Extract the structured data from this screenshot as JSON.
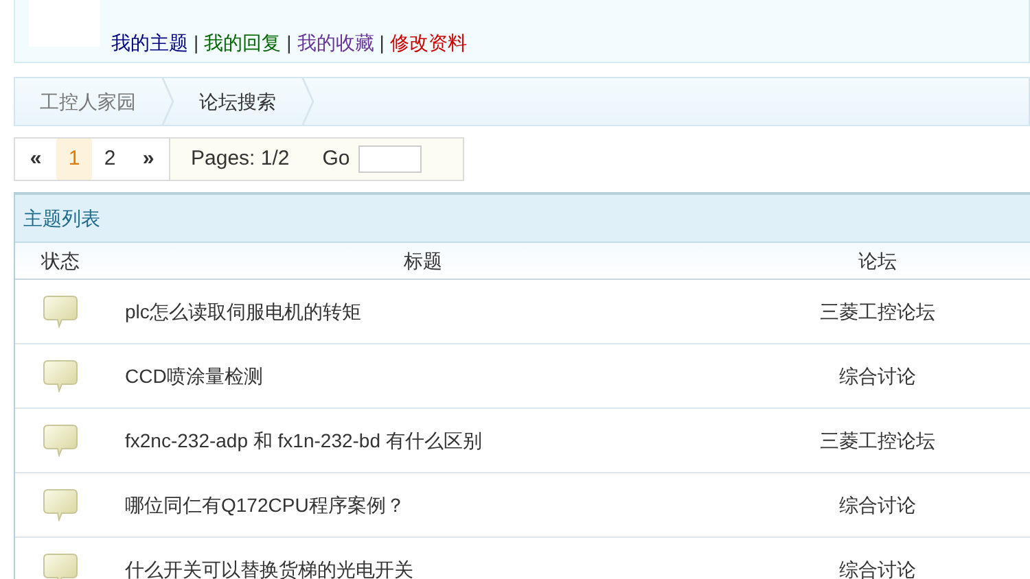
{
  "user_links": [
    {
      "label": "我的主题",
      "color": "#000080"
    },
    {
      "label": "我的回复",
      "color": "#006600"
    },
    {
      "label": "我的收藏",
      "color": "#663399"
    },
    {
      "label": "修改资料",
      "color": "#cc0000"
    }
  ],
  "separator": "|",
  "breadcrumb": [
    "工控人家园",
    "论坛搜索"
  ],
  "pagination": {
    "first": "«",
    "pages": [
      {
        "label": "1",
        "selected": true
      },
      {
        "label": "2",
        "selected": false
      }
    ],
    "last": "»",
    "info": "Pages: 1/2",
    "go": "Go"
  },
  "topic_list": {
    "title": "主题列表",
    "columns": [
      "状态",
      "标题",
      "论坛"
    ],
    "rows": [
      {
        "title": "plc怎么读取伺服电机的转矩",
        "forum": "三菱工控论坛"
      },
      {
        "title": "CCD喷涂量检测",
        "forum": "综合讨论"
      },
      {
        "title": "fx2nc-232-adp 和 fx1n-232-bd 有什么区别",
        "forum": "三菱工控论坛"
      },
      {
        "title": "哪位同仁有Q172CPU程序案例？",
        "forum": "综合讨论"
      },
      {
        "title": "什么开关可以替换货梯的光电开关",
        "forum": "综合讨论"
      }
    ]
  }
}
